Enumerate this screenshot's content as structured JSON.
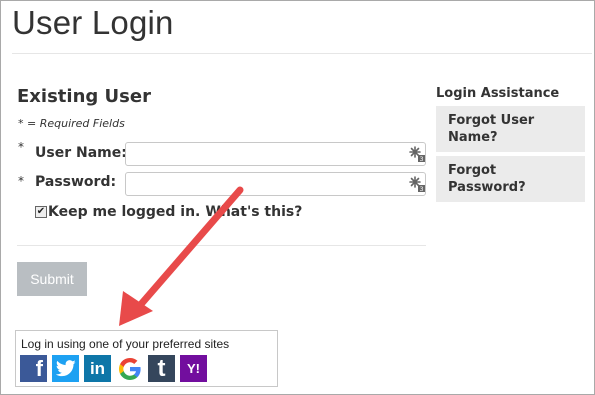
{
  "page": {
    "title": "User Login"
  },
  "existing_user": {
    "heading": "Existing User",
    "required_note": "* = Required Fields",
    "username_label": "User Name:",
    "password_label": "Password:",
    "required_mark": "*",
    "remember_label": "Keep me logged in.",
    "whats_this": "What's this?",
    "remember_checked": true,
    "submit_label": "Submit"
  },
  "assistance": {
    "heading": "Login Assistance",
    "items": [
      {
        "label": "Forgot User Name?"
      },
      {
        "label": "Forgot Password?"
      }
    ]
  },
  "social": {
    "title": "Log in using one of your preferred sites",
    "providers": [
      {
        "name": "facebook-icon",
        "glyph": "f",
        "color": "#3b5998"
      },
      {
        "name": "twitter-icon",
        "glyph": "t",
        "color": "#1da1f2"
      },
      {
        "name": "linkedin-icon",
        "glyph": "in",
        "color": "#0e76a8"
      },
      {
        "name": "google-icon",
        "glyph": "G",
        "color": "#ffffff"
      },
      {
        "name": "tumblr-icon",
        "glyph": "t",
        "color": "#35465c"
      },
      {
        "name": "yahoo-icon",
        "glyph": "Y!",
        "color": "#720e9e"
      }
    ]
  },
  "colors": {
    "arrow": "#e84a4a",
    "submit_bg": "#b9bec2",
    "assist_bg": "#ebebeb"
  }
}
